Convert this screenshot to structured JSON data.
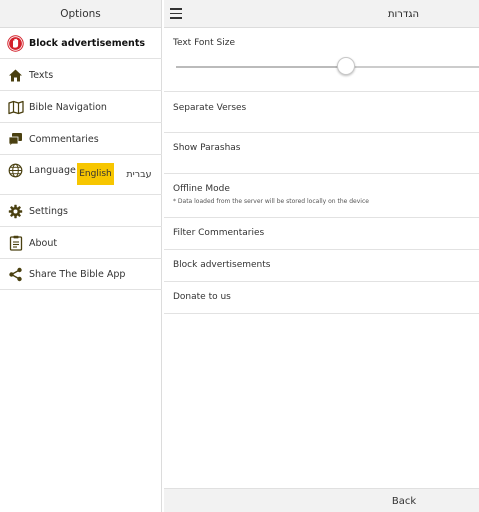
{
  "options_panel": {
    "title": "Options",
    "items": [
      {
        "id": "block-ads",
        "label": "Block advertisements",
        "icon": "hand-stop-icon"
      },
      {
        "id": "texts",
        "label": "Texts",
        "icon": "home-icon"
      },
      {
        "id": "bible-navigation",
        "label": "Bible Navigation",
        "icon": "map-icon"
      },
      {
        "id": "commentaries",
        "label": "Commentaries",
        "icon": "chat-icon"
      },
      {
        "id": "language",
        "label": "Language",
        "icon": "globe-icon"
      },
      {
        "id": "settings",
        "label": "Settings",
        "icon": "gear-icon"
      },
      {
        "id": "about",
        "label": "About",
        "icon": "clipboard-icon"
      },
      {
        "id": "share",
        "label": "Share The Bible App",
        "icon": "share-icon"
      }
    ],
    "language_options": {
      "english": "English",
      "hebrew": "עברית",
      "selected": "English"
    }
  },
  "settings_panel": {
    "title": "הגדרות",
    "font_size": {
      "label": "Text Font Size",
      "slider_value": 0.56
    },
    "items": [
      {
        "id": "separate-verses",
        "label": "Separate Verses"
      },
      {
        "id": "show-parashas",
        "label": "Show Parashas"
      },
      {
        "id": "offline-mode",
        "label": "Offline Mode",
        "note": "* Data loaded from the server will be stored locally on the device"
      },
      {
        "id": "filter-commentaries",
        "label": "Filter Commentaries"
      },
      {
        "id": "block-advertisements",
        "label": "Block advertisements"
      },
      {
        "id": "donate",
        "label": "Donate to us"
      }
    ],
    "back_label": "Back"
  },
  "colors": {
    "accent_yellow": "#f7c600",
    "stop_red": "#d3202a",
    "icon_dark": "#4a4010",
    "header_bg": "#f2f2f2"
  }
}
